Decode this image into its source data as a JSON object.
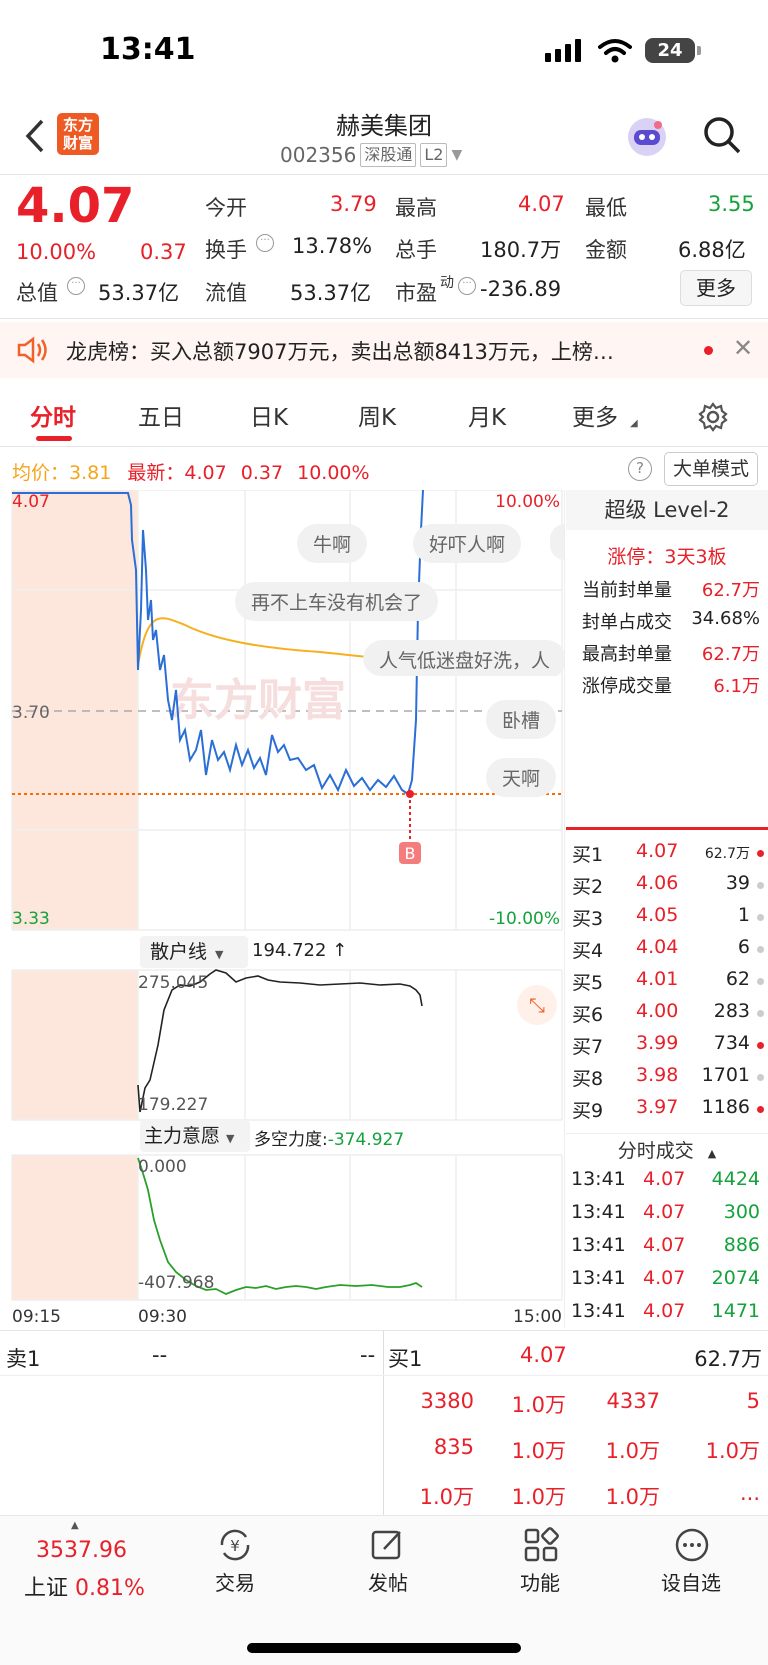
{
  "status_bar": {
    "time": "13:41",
    "battery": "24"
  },
  "header": {
    "title": "赫美集团",
    "code": "002356",
    "market_tag": "深股通",
    "level_tag": "L2",
    "logo_text": "东方财富"
  },
  "quote": {
    "price": "4.07",
    "change_pct": "10.00%",
    "change": "0.37",
    "open_label": "今开",
    "open": "3.79",
    "high_label": "最高",
    "high": "4.07",
    "low_label": "最低",
    "low": "3.55",
    "turnover_label": "换手",
    "turnover": "13.78%",
    "volume_label": "总手",
    "volume": "180.7万",
    "amount_label": "金额",
    "amount": "6.88亿",
    "total_mv_label": "总值",
    "total_mv": "53.37亿",
    "float_mv_label": "流值",
    "float_mv": "53.37亿",
    "pe_label": "市盈",
    "pe_sup": "动",
    "pe": "-236.89",
    "more_button": "更多"
  },
  "notice": {
    "text": "龙虎榜：买入总额7907万元，卖出总额8413万元，上榜…"
  },
  "tabs": [
    "分时",
    "五日",
    "日K",
    "周K",
    "月K",
    "更多"
  ],
  "chart_info": {
    "avg_label": "均价：",
    "avg": "3.81",
    "latest_label": "最新：",
    "latest": "4.07",
    "latest_change": "0.37",
    "latest_pct": "10.00%",
    "mode_button": "大单模式"
  },
  "chart_labels": {
    "y_top": "4.07",
    "y_mid": "3.70",
    "y_bottom": "3.33",
    "pct_top": "10.00%",
    "pct_bottom": "-10.00%",
    "marker": "B",
    "retail_label": "散户线",
    "retail_value": "194.722",
    "retail_high": "275.045",
    "retail_low": "179.227",
    "main_label": "主力意愿",
    "main_force_label": "多空力度:",
    "main_force_value": "-374.927",
    "main_top": "0.000",
    "main_low": "-407.968",
    "t_start": "09:15",
    "t_open": "09:30",
    "t_end": "15:00",
    "watermark": "东方财富"
  },
  "comments": [
    "牛啊",
    "好吓人啊",
    "再不上车没有机会了",
    "人气低迷盘好洗，人",
    "卧槽",
    "天啊"
  ],
  "right_panel": {
    "title": "超级 Level-2",
    "limit_up": "涨停：3天3板",
    "stats": [
      {
        "label": "当前封单量",
        "value": "62.7万"
      },
      {
        "label": "封单占成交",
        "value": "34.68%"
      },
      {
        "label": "最高封单量",
        "value": "62.7万"
      },
      {
        "label": "涨停成交量",
        "value": "6.1万"
      }
    ],
    "book": [
      {
        "label": "买1",
        "price": "4.07",
        "vol": "62.7万"
      },
      {
        "label": "买2",
        "price": "4.06",
        "vol": "39"
      },
      {
        "label": "买3",
        "price": "4.05",
        "vol": "1"
      },
      {
        "label": "买4",
        "price": "4.04",
        "vol": "6"
      },
      {
        "label": "买5",
        "price": "4.01",
        "vol": "62"
      },
      {
        "label": "买6",
        "price": "4.00",
        "vol": "283"
      },
      {
        "label": "买7",
        "price": "3.99",
        "vol": "734"
      },
      {
        "label": "买8",
        "price": "3.98",
        "vol": "1701"
      },
      {
        "label": "买9",
        "price": "3.97",
        "vol": "1186"
      }
    ],
    "ticks_title": "分时成交",
    "ticks": [
      {
        "time": "13:41",
        "price": "4.07",
        "vol": "4424"
      },
      {
        "time": "13:41",
        "price": "4.07",
        "vol": "300"
      },
      {
        "time": "13:41",
        "price": "4.07",
        "vol": "886"
      },
      {
        "time": "13:41",
        "price": "4.07",
        "vol": "2074"
      },
      {
        "time": "13:41",
        "price": "4.07",
        "vol": "1471"
      }
    ]
  },
  "bottom_book": {
    "sell_label": "卖1",
    "sell_price": "--",
    "sell_vol": "--",
    "buy_label": "买1",
    "buy_price": "4.07",
    "buy_vol": "62.7万",
    "queue": [
      "3380",
      "1.0万",
      "4337",
      "5",
      "835",
      "1.0万",
      "1.0万",
      "1.0万",
      "1.0万",
      "1.0万",
      "1.0万",
      "..."
    ]
  },
  "bottom_nav": {
    "index_value": "3537.96",
    "index_name": "上证",
    "index_pct": "0.81%",
    "items": [
      "交易",
      "发帖",
      "功能",
      "设自选"
    ]
  }
}
